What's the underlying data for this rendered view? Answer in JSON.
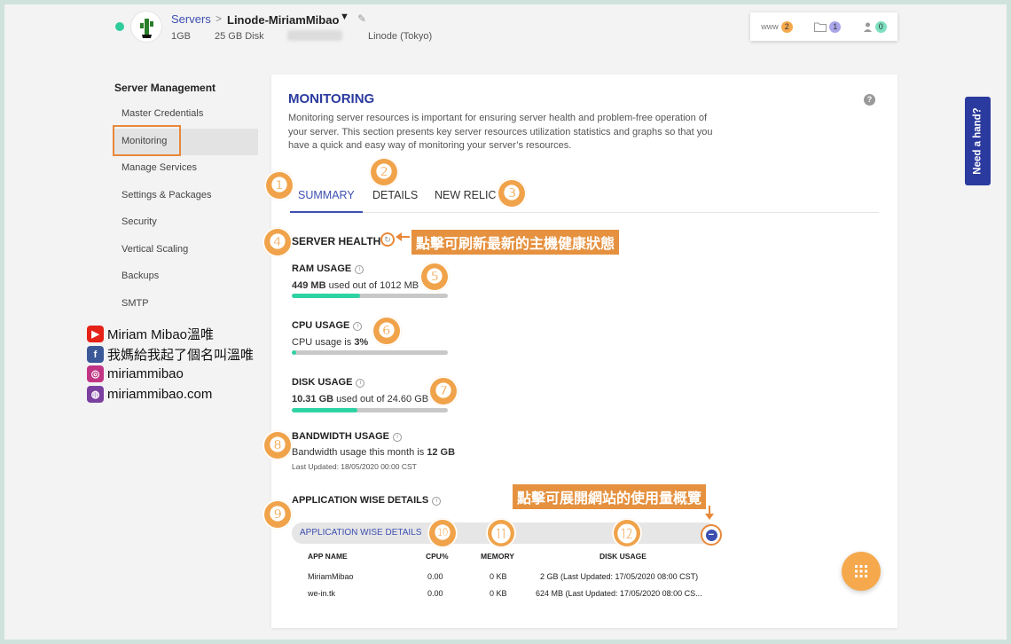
{
  "header": {
    "breadcrumb_root": "Servers",
    "breadcrumb_sep": ">",
    "server_name": "Linode-MiriamMibao",
    "ram": "1GB",
    "disk": "25 GB Disk",
    "location": "Linode (Tokyo)",
    "widget": [
      {
        "icon": "www-icon",
        "label": "www",
        "count": "2",
        "color": "#f5a94c"
      },
      {
        "icon": "folder-icon",
        "label": "",
        "count": "1",
        "color": "#a9a6ea"
      },
      {
        "icon": "user-icon",
        "label": "",
        "count": "0",
        "color": "#7ee0c0"
      }
    ]
  },
  "sidebar": {
    "title": "Server Management",
    "items": [
      {
        "label": "Master Credentials"
      },
      {
        "label": "Monitoring",
        "active": true
      },
      {
        "label": "Manage Services"
      },
      {
        "label": "Settings & Packages"
      },
      {
        "label": "Security"
      },
      {
        "label": "Vertical Scaling"
      },
      {
        "label": "Backups"
      },
      {
        "label": "SMTP"
      }
    ]
  },
  "social": [
    {
      "icon": "youtube-icon",
      "text": "Miriam Mibao溫唯",
      "color": "#e62117"
    },
    {
      "icon": "facebook-icon",
      "text": "我媽給我起了個名叫溫唯",
      "color": "#3b5998"
    },
    {
      "icon": "instagram-icon",
      "text": "miriammibao",
      "color": "#c13584"
    },
    {
      "icon": "globe-icon",
      "text": "miriammibao.com",
      "color": "#7b3fa0"
    }
  ],
  "monitoring": {
    "title": "MONITORING",
    "description": "Monitoring server resources is important for ensuring server health and problem-free operation of your server. This section presents key server resources utilization statistics and graphs so that you have a quick and easy way of monitoring your server’s resources.",
    "tabs": [
      "SUMMARY",
      "DETAILS",
      "NEW RELIC"
    ],
    "server_health": "SERVER HEALTH",
    "ram": {
      "title": "RAM USAGE",
      "used": "449 MB",
      "mid": " used out of ",
      "total": "1012 MB",
      "fraction": 0.44
    },
    "cpu": {
      "title": "CPU USAGE",
      "prefix": "CPU usage is ",
      "value": "3%",
      "fraction": 0.03
    },
    "disk": {
      "title": "DISK USAGE",
      "used": "10.31 GB",
      "mid": " used out of ",
      "total": "24.60 GB",
      "fraction": 0.42
    },
    "bandwidth": {
      "title": "BANDWIDTH USAGE",
      "prefix": "Bandwidth usage this month is ",
      "value": "12 GB",
      "updated": "Last Updated: 18/05/2020 00:00 CST"
    },
    "app_details": {
      "title": "APPLICATION WISE DETAILS",
      "accordion_label": "APPLICATION WISE DETAILS",
      "columns": [
        "APP NAME",
        "CPU%",
        "MEMORY",
        "DISK USAGE"
      ],
      "rows": [
        {
          "name": "MiriamMibao",
          "cpu": "0.00",
          "memory": "0 KB",
          "disk": "2 GB (Last Updated: 17/05/2020 08:00 CST)"
        },
        {
          "name": "we-in.tk",
          "cpu": "0.00",
          "memory": "0 KB",
          "disk": "624 MB (Last Updated: 17/05/2020 08:00 CS..."
        }
      ]
    }
  },
  "annotations": {
    "refresh_note": "點擊可刷新最新的主機健康狀態",
    "expand_note": "點擊可展開網站的使用量概覽",
    "markers": [
      "❶",
      "❷",
      "❸",
      "❹",
      "❺",
      "❻",
      "❼",
      "❽",
      "❾",
      "❿",
      "⓫",
      "⓬"
    ]
  },
  "need_hand": "Need a hand?"
}
